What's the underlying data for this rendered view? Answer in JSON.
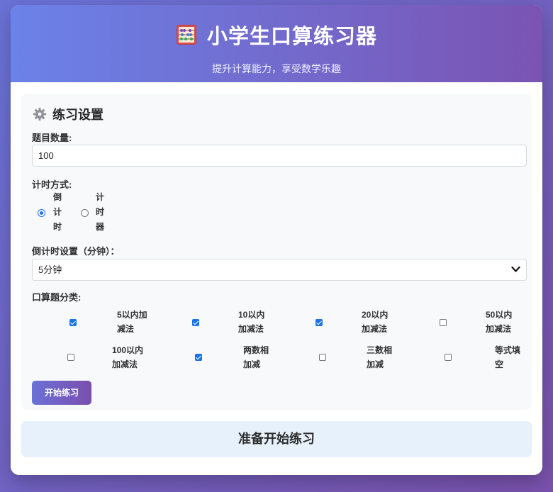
{
  "header": {
    "title": "小学生口算练习器",
    "subtitle": "提升计算能力，享受数学乐趣",
    "icon": "abacus-icon"
  },
  "settings": {
    "title": "练习设置",
    "icon": "gear-icon",
    "question_count": {
      "label": "题目数量:",
      "value": "100"
    },
    "timing": {
      "label": "计时方式:",
      "options": [
        {
          "label": "倒计时",
          "checked": true
        },
        {
          "label": "计时器",
          "checked": false
        }
      ]
    },
    "countdown": {
      "label": "倒计时设置（分钟）：",
      "selected": "5分钟"
    },
    "categories": {
      "label": "口算题分类:",
      "items": [
        {
          "label": "5以内加减法",
          "checked": true
        },
        {
          "label": "10以内加减法",
          "checked": true
        },
        {
          "label": "20以内加减法",
          "checked": true
        },
        {
          "label": "50以内加减法",
          "checked": false
        },
        {
          "label": "100以内加减法",
          "checked": false
        },
        {
          "label": "两数相加减",
          "checked": true
        },
        {
          "label": "三数相加减",
          "checked": false
        },
        {
          "label": "等式填空",
          "checked": false
        }
      ]
    },
    "start_button": "开始练习"
  },
  "status": "准备开始练习",
  "colors": {
    "accent_start": "#6b82e8",
    "accent_end": "#7a54b3",
    "checkbox_checked": "#1a73e8",
    "status_bg": "#e6f1fb"
  }
}
